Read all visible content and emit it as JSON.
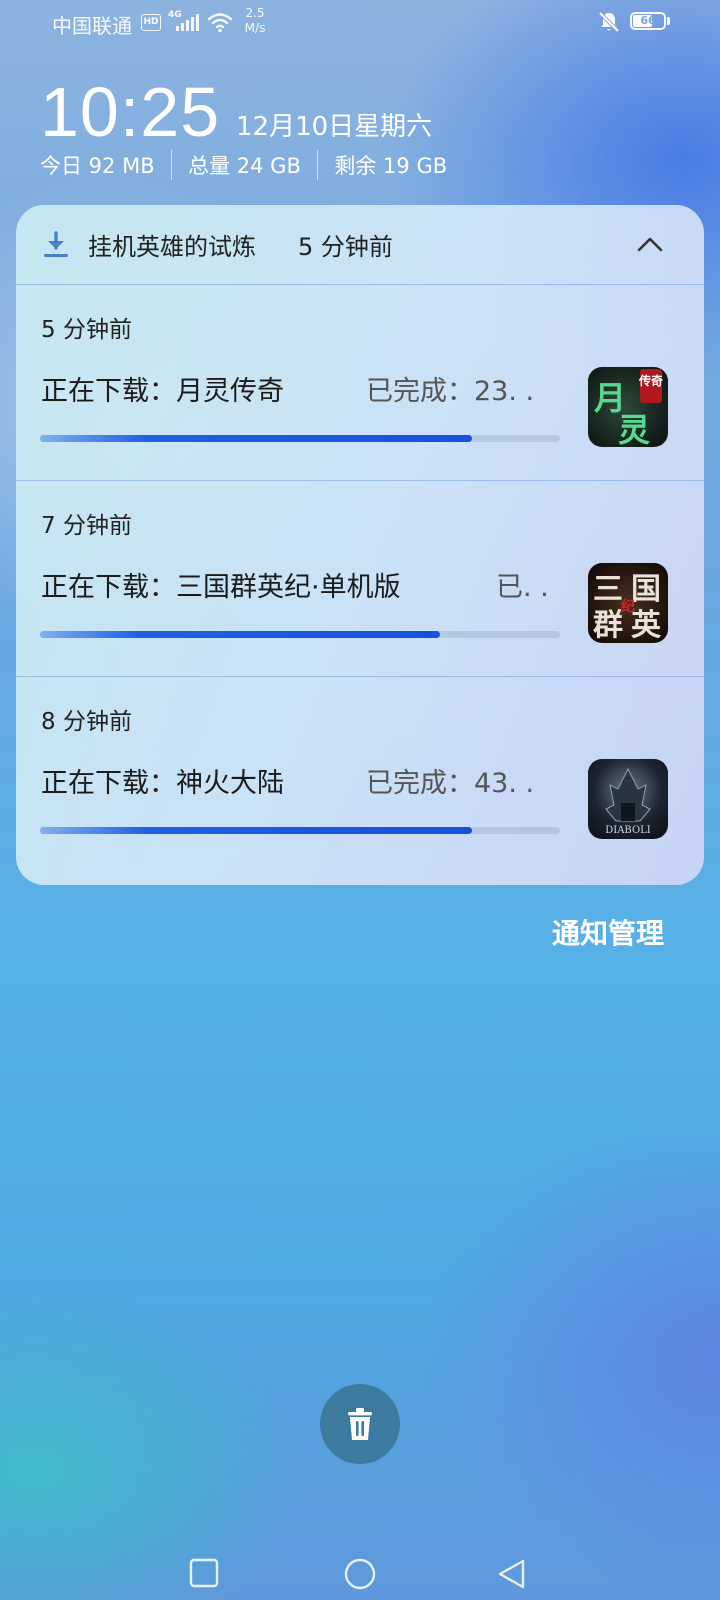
{
  "status_bar": {
    "carrier": "中国联通",
    "hd": "HD",
    "network": "4G",
    "speed_value": "2.5",
    "speed_unit": "M/s",
    "battery_level": "66",
    "battery_fraction": 0.66,
    "icons": [
      "signal-icon",
      "wifi-icon",
      "bell-off-icon",
      "battery-icon"
    ]
  },
  "lockscreen": {
    "time": "10:25",
    "date": "12月10日星期六",
    "storage": {
      "today": "今日 92 MB",
      "total": "总量 24 GB",
      "remaining": "剩余 19 GB"
    }
  },
  "notification_group": {
    "app_name": "挂机英雄的试炼",
    "time": "5 分钟前",
    "icon": "download-icon",
    "collapse_icon": "chevron-up-icon",
    "items": [
      {
        "time": "5 分钟前",
        "title": "正在下载：月灵传奇",
        "status": "已完成：23. .",
        "progress": 0.83,
        "icon_chars": [
          "月",
          "灵"
        ],
        "icon_badge": "传奇"
      },
      {
        "time": "7 分钟前",
        "title": "正在下载：三国群英纪·单机版",
        "status": "已. .",
        "progress": 0.77,
        "icon_chars": [
          "三",
          "国",
          "群",
          "英"
        ],
        "icon_badge": "纪"
      },
      {
        "time": "8 分钟前",
        "title": "正在下载：神火大陆",
        "status": "已完成：43. .",
        "progress": 0.83,
        "icon_chars": [
          "DIABOLI"
        ],
        "icon_badge": ""
      }
    ]
  },
  "actions": {
    "manage": "通知管理",
    "clear_icon": "trash-icon"
  },
  "nav": {
    "recent_icon": "square-icon",
    "home_icon": "circle-icon",
    "back_icon": "triangle-back-icon"
  },
  "colors": {
    "progress": "#1652db",
    "trash_bg": "#3d7aa0"
  }
}
